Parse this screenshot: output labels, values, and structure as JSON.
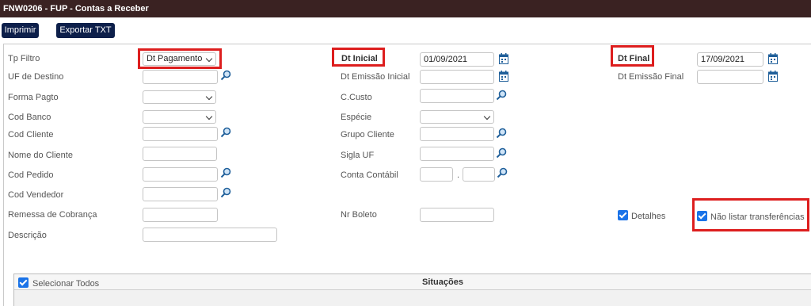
{
  "window": {
    "title": "FNW0206 - FUP - Contas a Receber"
  },
  "toolbar": {
    "print_label": "Imprimir",
    "export_label": "Exportar TXT"
  },
  "form": {
    "tp_filtro": {
      "label": "Tp Filtro",
      "value": "Dt Pagamento"
    },
    "dt_inicial": {
      "label": "Dt Inicial",
      "value": "01/09/2021"
    },
    "dt_final": {
      "label": "Dt Final",
      "value": "17/09/2021"
    },
    "uf_destino": {
      "label": "UF de Destino",
      "value": ""
    },
    "dt_emissao_inicial": {
      "label": "Dt Emissão Inicial",
      "value": ""
    },
    "dt_emissao_final": {
      "label": "Dt Emissão Final",
      "value": ""
    },
    "forma_pagto": {
      "label": "Forma Pagto",
      "value": ""
    },
    "c_custo": {
      "label": "C.Custo",
      "value": ""
    },
    "cod_banco": {
      "label": "Cod Banco",
      "value": ""
    },
    "especie": {
      "label": "Espécie",
      "value": ""
    },
    "cod_cliente": {
      "label": "Cod Cliente",
      "value": ""
    },
    "grupo_cliente": {
      "label": "Grupo Cliente",
      "value": ""
    },
    "nome_cliente": {
      "label": "Nome do Cliente",
      "value": ""
    },
    "sigla_uf": {
      "label": "Sigla UF",
      "value": ""
    },
    "cod_pedido": {
      "label": "Cod Pedido",
      "value": ""
    },
    "conta_contabil": {
      "label": "Conta Contábil",
      "value_a": "",
      "separator": ".",
      "value_b": ""
    },
    "cod_vendedor": {
      "label": "Cod Vendedor",
      "value": ""
    },
    "remessa_cobranca": {
      "label": "Remessa de Cobrança",
      "value": ""
    },
    "nr_boleto": {
      "label": "Nr Boleto",
      "value": ""
    },
    "descricao": {
      "label": "Descrição",
      "value": ""
    },
    "detalhes": {
      "label": "Detalhes",
      "checked": true
    },
    "nao_listar_transferencias": {
      "label": "Não listar transferências",
      "checked": true
    }
  },
  "situacoes": {
    "title": "Situações",
    "select_all_label": "Selecionar Todos",
    "select_all_checked": true
  },
  "colors": {
    "titlebar_bg": "#3a2222",
    "button_bg": "#0d1f4a",
    "highlight": "#dd1e1e",
    "checkbox": "#1a73e8",
    "icon": "#1f5f9a"
  }
}
